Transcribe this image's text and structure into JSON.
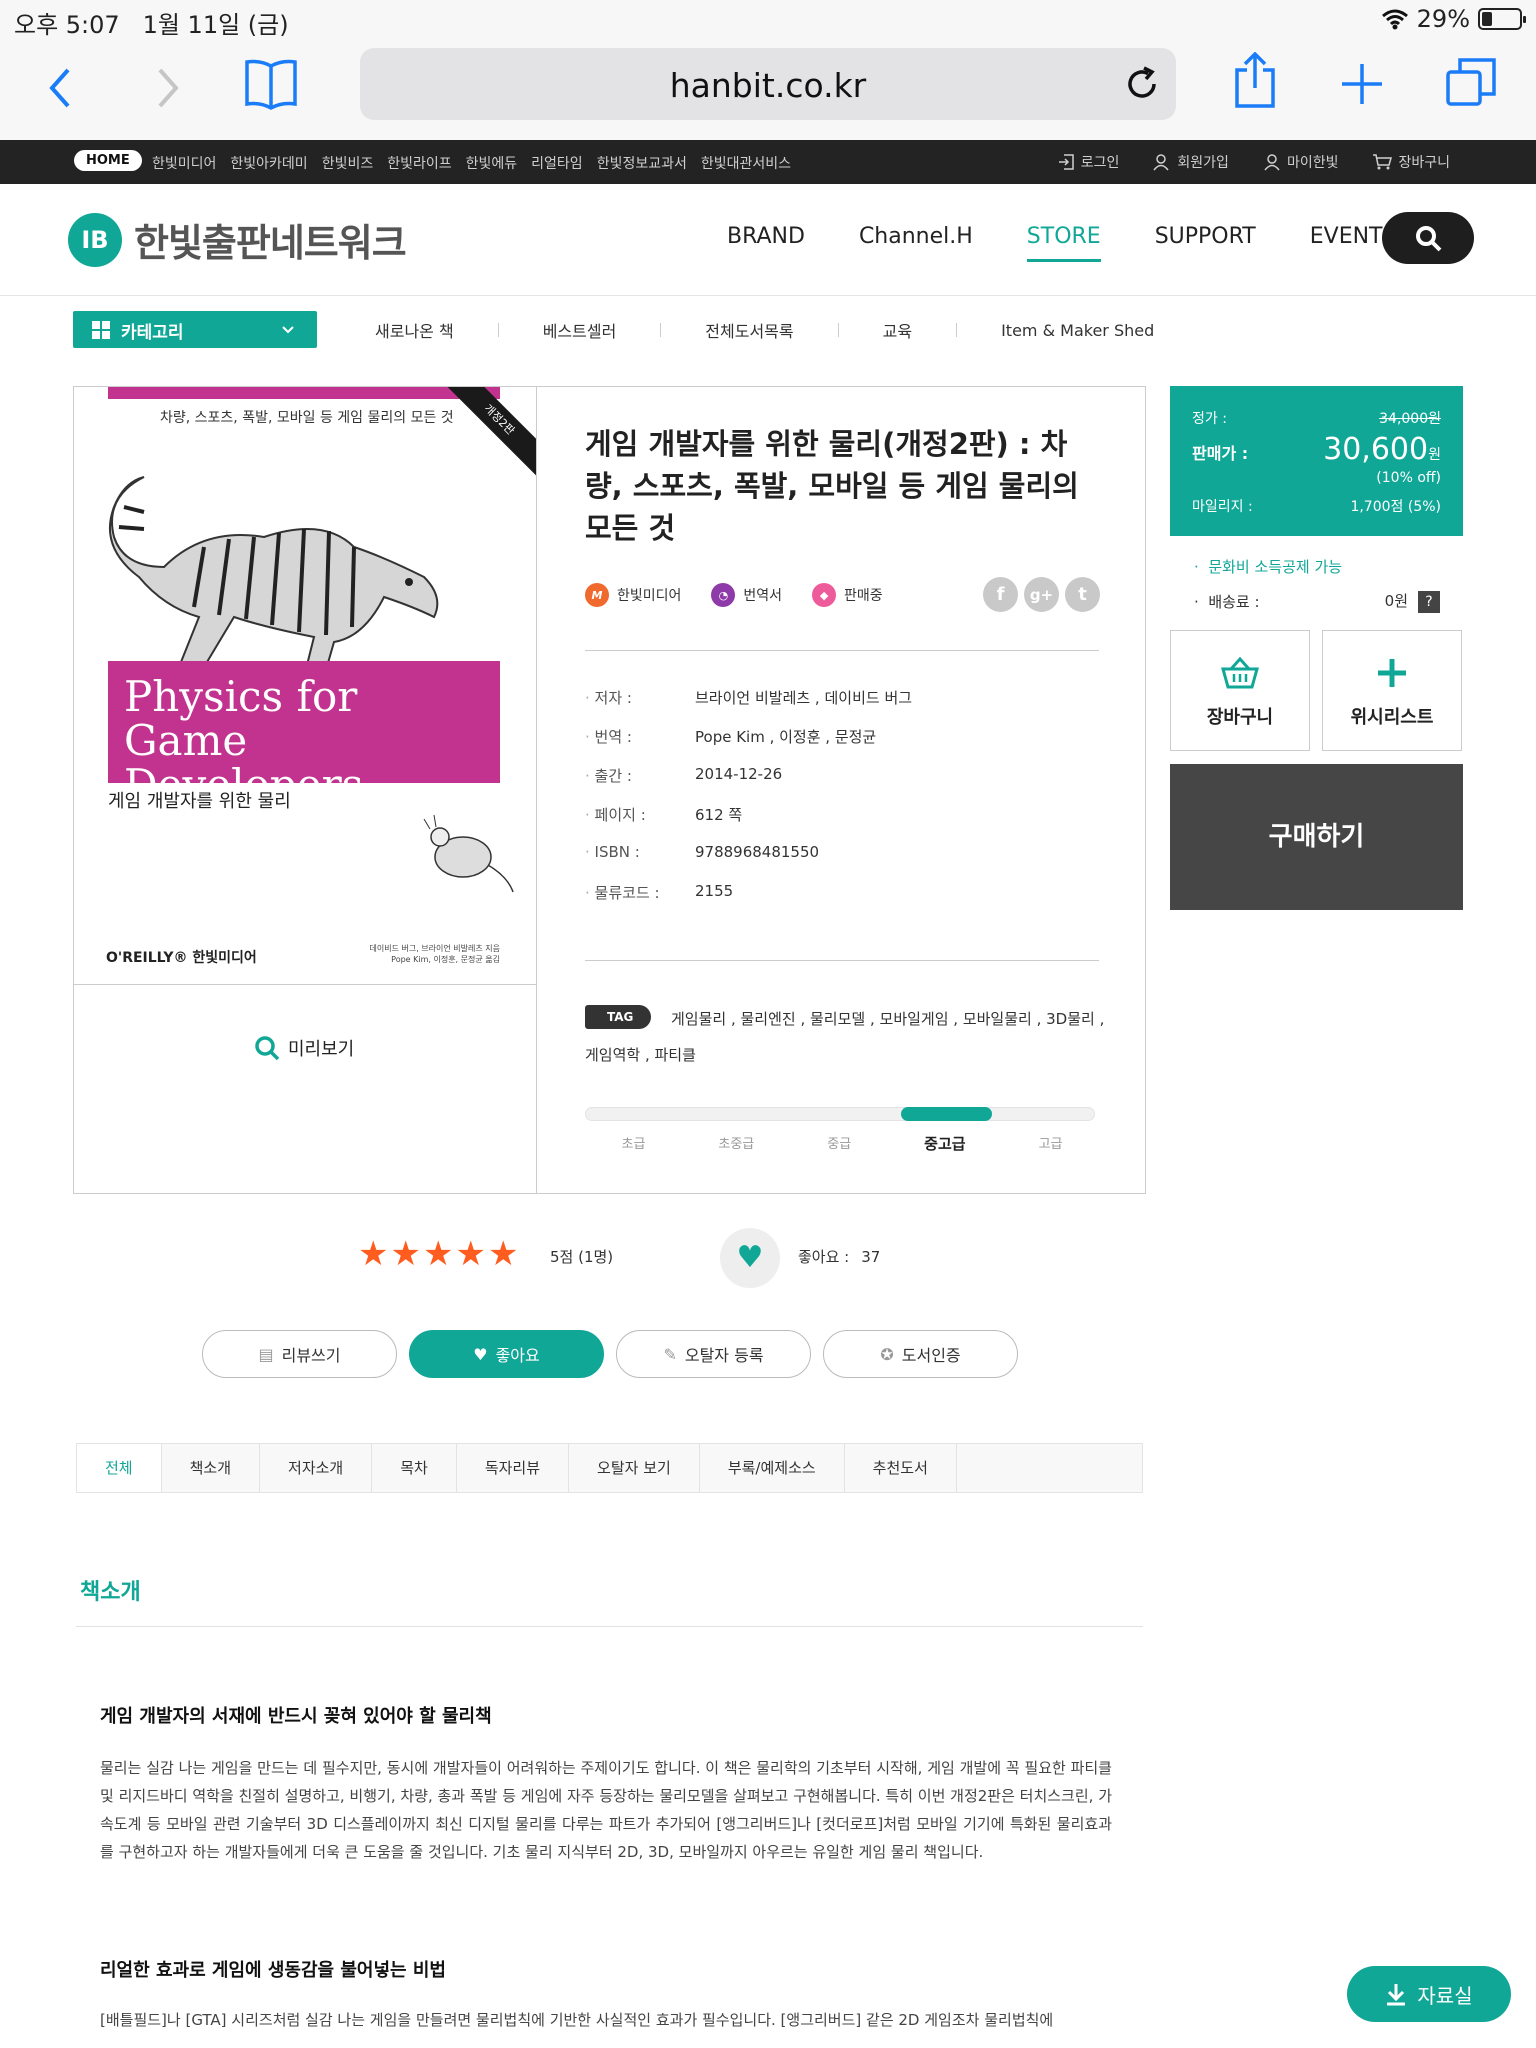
{
  "status_bar": {
    "time": "오후 5:07",
    "date": "1월 11일 (금)",
    "battery": "29%"
  },
  "browser": {
    "url": "hanbit.co.kr"
  },
  "top_nav": {
    "home": "HOME",
    "links": [
      "한빛미디어",
      "한빛아카데미",
      "한빛비즈",
      "한빛라이프",
      "한빛에듀",
      "리얼타임",
      "한빛정보교과서",
      "한빛대관서비스"
    ],
    "login": "로그인",
    "signup": "회원가입",
    "mypage": "마이한빛",
    "cart": "장바구니"
  },
  "header": {
    "logo_text": "한빛출판네트워크",
    "logo_mark": "IB",
    "nav": [
      "BRAND",
      "Channel.H",
      "STORE",
      "SUPPORT",
      "EVENT"
    ]
  },
  "category": {
    "label": "카테고리",
    "items": [
      "새로나온 책",
      "베스트셀러",
      "전체도서목록",
      "교육",
      "Item & Maker Shed"
    ]
  },
  "cover": {
    "subtitle": "차량, 스포츠, 폭발, 모바일 등 게임 물리의 모든 것",
    "ribbon": "개정2판",
    "title_line1": "Physics for",
    "title_line2": "Game Developers",
    "ko_title": "게임 개발자를 위한 물리",
    "publisher": "O'REILLY® 한빛미디어",
    "authors_line1": "데이비드 버그, 브라이언 비발레츠 지음",
    "authors_line2": "Pope Kim, 이정훈, 문정균 옮김"
  },
  "preview_label": "미리보기",
  "book": {
    "title": "게임 개발자를 위한 물리(개정2판) : 차량, 스포츠, 폭발, 모바일 등 게임 물리의 모든 것",
    "badges": [
      {
        "mark": "M",
        "label": "한빛미디어"
      },
      {
        "mark": "",
        "label": "번역서"
      },
      {
        "mark": "",
        "label": "판매중"
      }
    ],
    "social": [
      "f",
      "g+",
      "t"
    ],
    "details": [
      {
        "k": "저자 :",
        "v": "브라이언 비발레츠 , 데이비드 버그"
      },
      {
        "k": "번역 :",
        "v": "Pope Kim , 이정훈 , 문정균"
      },
      {
        "k": "출간 :",
        "v": "2014-12-26"
      },
      {
        "k": "페이지 :",
        "v": "612 쪽"
      },
      {
        "k": "ISBN :",
        "v": "9788968481550"
      },
      {
        "k": "물류코드 :",
        "v": "2155"
      }
    ],
    "tag_label": "TAG",
    "tags": "게임물리 , 물리엔진 , 물리모델 , 모바일게임 , 모바일물리 , 3D물리 , 게임역학 , 파티클",
    "levels": [
      "초급",
      "초중급",
      "중급",
      "중고급",
      "고급"
    ],
    "current_level_index": 3
  },
  "price": {
    "list_label": "정가 :",
    "list_price": "34,000원",
    "sale_label": "판매가 :",
    "sale_price": "30,600",
    "sale_unit": "원",
    "discount": "(10% off)",
    "mileage_label": "마일리지 :",
    "mileage": "1,700점 (5%)",
    "deduction": "문화비 소득공제 가능",
    "shipping_label": "배송료 :",
    "shipping": "0원",
    "help": "?",
    "cart": "장바구니",
    "wishlist": "위시리스트",
    "buy": "구매하기"
  },
  "rating": {
    "stars": 5,
    "text": "5점 (1명)",
    "like_label": "좋아요 :",
    "like_count": "37"
  },
  "action_buttons": [
    "리뷰쓰기",
    "좋아요",
    "오탈자 등록",
    "도서인증"
  ],
  "tabs": [
    "전체",
    "책소개",
    "저자소개",
    "목차",
    "독자리뷰",
    "오탈자 보기",
    "부록/예제소스",
    "추천도서"
  ],
  "intro": {
    "section_title": "책소개",
    "heading1": "게임 개발자의 서재에 반드시 꽂혀 있어야 할 물리책",
    "para1": "물리는 실감 나는 게임을 만드는 데 필수지만, 동시에 개발자들이 어려워하는 주제이기도 합니다.  이 책은 물리학의 기초부터 시작해, 게임 개발에 꼭 필요한 파티클 및 리지드바디 역학을 친절히 설명하고, 비행기, 차량, 총과 폭발 등 게임에 자주 등장하는 물리모델을 살펴보고 구현해봅니다. 특히 이번 개정2판은 터치스크린, 가속도계 등 모바일 관련 기술부터 3D 디스플레이까지 최신 디지털 물리를 다루는 파트가 추가되어 [앵그리버드]나 [컷더로프]처럼 모바일 기기에 특화된 물리효과를 구현하고자 하는 개발자들에게 더욱 큰 도움을 줄 것입니다. 기초 물리 지식부터 2D, 3D, 모바일까지 아우르는 유일한 게임 물리 책입니다.",
    "heading2": "리얼한 효과로 게임에 생동감을 불어넣는 비법",
    "para2": "[배틀필드]나 [GTA] 시리즈처럼 실감 나는 게임을 만들려면 물리법칙에 기반한 사실적인 효과가 필수입니다. [앵그리버드] 같은 2D 게임조차 물리법칙에"
  },
  "float_button": "자료실"
}
